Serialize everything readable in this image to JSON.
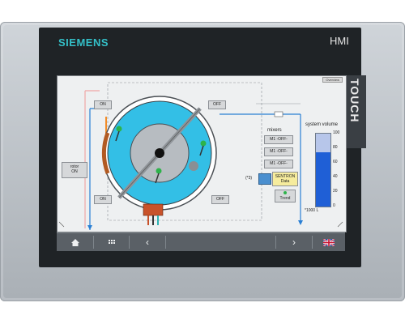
{
  "device": {
    "brand": "SIEMENS",
    "model": "HMI",
    "side_label": "TOUCH"
  },
  "screen": {
    "overview_button": "Overview",
    "left_buttons": {
      "top_on": "ON",
      "rotor_on_line1": "rotor",
      "rotor_on_line2": "ON",
      "bottom_on": "ON"
    },
    "right_buttons": {
      "top_off": "OFF",
      "bottom_off": "OFF"
    },
    "mixers": {
      "title": "mixers",
      "items": [
        "M1 -OFF-",
        "M1 -OFF-",
        "M1 -OFF-"
      ]
    },
    "sentron": {
      "tag": "(*3)",
      "line1": "SENTRON",
      "line2": "Data"
    },
    "trend_button": "Trend",
    "system_volume": {
      "title": "system volume",
      "ticks": [
        "100",
        "80",
        "60",
        "40",
        "20",
        "0"
      ],
      "unit": "*1000 L",
      "fill_fraction": 0.75
    },
    "colors": {
      "vessel": "#33bfe6",
      "volume_bar": "#1f5fd6",
      "volume_upper": "#b7c6ea",
      "pipe_blue": "#2a7fd4",
      "pipe_orange": "#f28c28",
      "pipe_pink": "#f0a7a7"
    }
  },
  "navbar": {
    "home_icon": "home-icon",
    "menu_icon": "grid-menu-icon",
    "prev_icon": "chevron-left-icon",
    "next_icon": "chevron-right-icon",
    "language_icon": "uk-flag-icon"
  }
}
